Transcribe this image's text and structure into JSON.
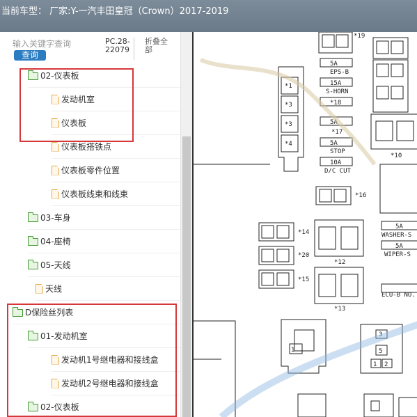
{
  "header": {
    "title": "当前车型： 厂家:Y-一汽丰田皇冠（Crown）2017-2019"
  },
  "search": {
    "placeholder": "输入关键字查询",
    "button_label": "查询"
  },
  "toolbar": {
    "pc_code": "PC.28-22079",
    "collapse_all_label": "折叠全部"
  },
  "tree": [
    {
      "label": "02-仪表板",
      "type": "folder"
    },
    {
      "label": "发动机室",
      "type": "file"
    },
    {
      "label": "仪表板",
      "type": "file"
    },
    {
      "label": "仪表板搭铁点",
      "type": "file"
    },
    {
      "label": "仪表板零件位置",
      "type": "file"
    },
    {
      "label": "仪表板线束和线束",
      "type": "file"
    },
    {
      "label": "03-车身",
      "type": "folder"
    },
    {
      "label": "04-座椅",
      "type": "folder"
    },
    {
      "label": "05-天线",
      "type": "folder"
    },
    {
      "label": "天线",
      "type": "file"
    },
    {
      "label": "D保险丝列表",
      "type": "folder"
    },
    {
      "label": "01-发动机室",
      "type": "folder"
    },
    {
      "label": "发动机1号继电器和接线盒",
      "type": "file"
    },
    {
      "label": "发动机2号继电器和接线盒",
      "type": "file"
    },
    {
      "label": "02-仪表板",
      "type": "folder"
    }
  ],
  "diagram": {
    "labels": {
      "s19": "*19",
      "s1": "*1",
      "s3": "*3",
      "s3b": "*3",
      "s4": "*4",
      "f5a": "5A",
      "eps": "EPS-B",
      "f15a": "15A",
      "shorn": "S-HORN",
      "s18": "*18",
      "f5a2": "5A",
      "s17": "*17",
      "f5a3": "5A",
      "stop": "STOP",
      "f10a": "10A",
      "dccut": "D/C CUT",
      "s10": "*10",
      "s16": "*16",
      "s14": "*14",
      "s20": "*20",
      "s15": "*15",
      "s12": "*12",
      "s13": "*13",
      "f5a4": "5A",
      "washer": "WASHER-S",
      "f5a5": "5A",
      "wiper": "WIPER-S",
      "ecu": "ECU-B NO.",
      "n1": "1",
      "n2": "2",
      "n3": "3",
      "n4": "4",
      "n5": "5"
    }
  }
}
